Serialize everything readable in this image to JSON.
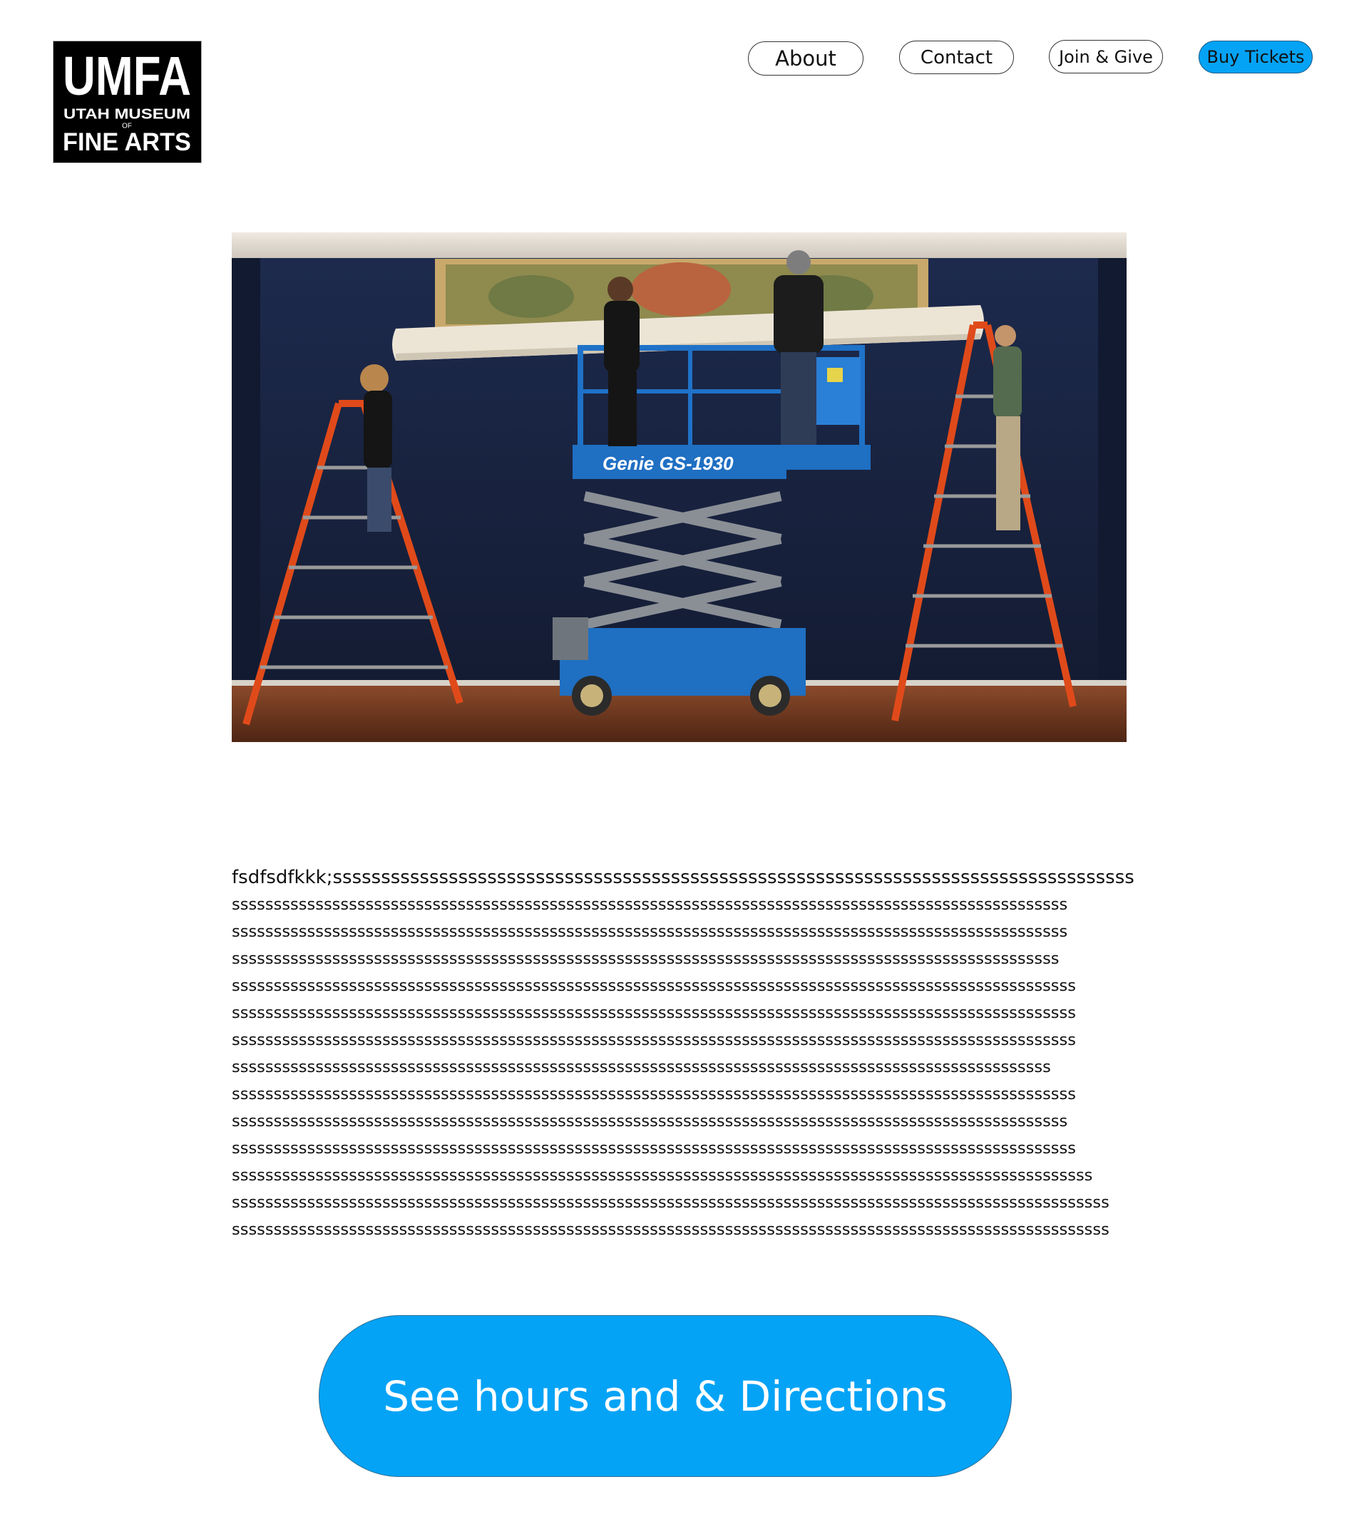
{
  "logo": {
    "main": "UMFA",
    "line1": "UTAH MUSEUM",
    "of": "OF",
    "line2": "FINE ARTS"
  },
  "nav": {
    "about": "About",
    "contact": "Contact",
    "join": "Join & Give",
    "tickets": "Buy Tickets"
  },
  "hero": {
    "lift_label": "Genie GS-1930"
  },
  "body": {
    "lines": [
      "fsdfsdfkkk;sssssssssssssssssssssssssssssssssssssssssssssssssssssssssssssssssssssssssssssssssss",
      "ssssssssssssssssssssssssssssssssssssssssssssssssssssssssssssssssssssssssssssssssssssssssssssssssssss",
      "ssssssssssssssssssssssssssssssssssssssssssssssssssssssssssssssssssssssssssssssssssssssssssssssssssss",
      "sssssssssssssssssssssssssssssssssssssssssssssssssssssssssssssssssssssssssssssssssssssssssssssssssss",
      "sssssssssssssssssssssssssssssssssssssssssssssssssssssssssssssssssssssssssssssssssssssssssssssssssssss",
      "sssssssssssssssssssssssssssssssssssssssssssssssssssssssssssssssssssssssssssssssssssssssssssssssssssss",
      "sssssssssssssssssssssssssssssssssssssssssssssssssssssssssssssssssssssssssssssssssssssssssssssssssssss",
      "ssssssssssssssssssssssssssssssssssssssssssssssssssssssssssssssssssssssssssssssssssssssssssssssssss",
      "sssssssssssssssssssssssssssssssssssssssssssssssssssssssssssssssssssssssssssssssssssssssssssssssssssss",
      "ssssssssssssssssssssssssssssssssssssssssssssssssssssssssssssssssssssssssssssssssssssssssssssssssssss",
      "sssssssssssssssssssssssssssssssssssssssssssssssssssssssssssssssssssssssssssssssssssssssssssssssssssss",
      "sssssssssssssssssssssssssssssssssssssssssssssssssssssssssssssssssssssssssssssssssssssssssssssssssssssss",
      "sssssssssssssssssssssssssssssssssssssssssssssssssssssssssssssssssssssssssssssssssssssssssssssssssssssssss",
      "sssssssssssssssssssssssssssssssssssssssssssssssssssssssssssssssssssssssssssssssssssssssssssssssssssssssss"
    ]
  },
  "cta": {
    "label": "See hours and & Directions"
  },
  "colors": {
    "accent": "#05a3f6",
    "text": "#111111",
    "background": "#ffffff"
  }
}
